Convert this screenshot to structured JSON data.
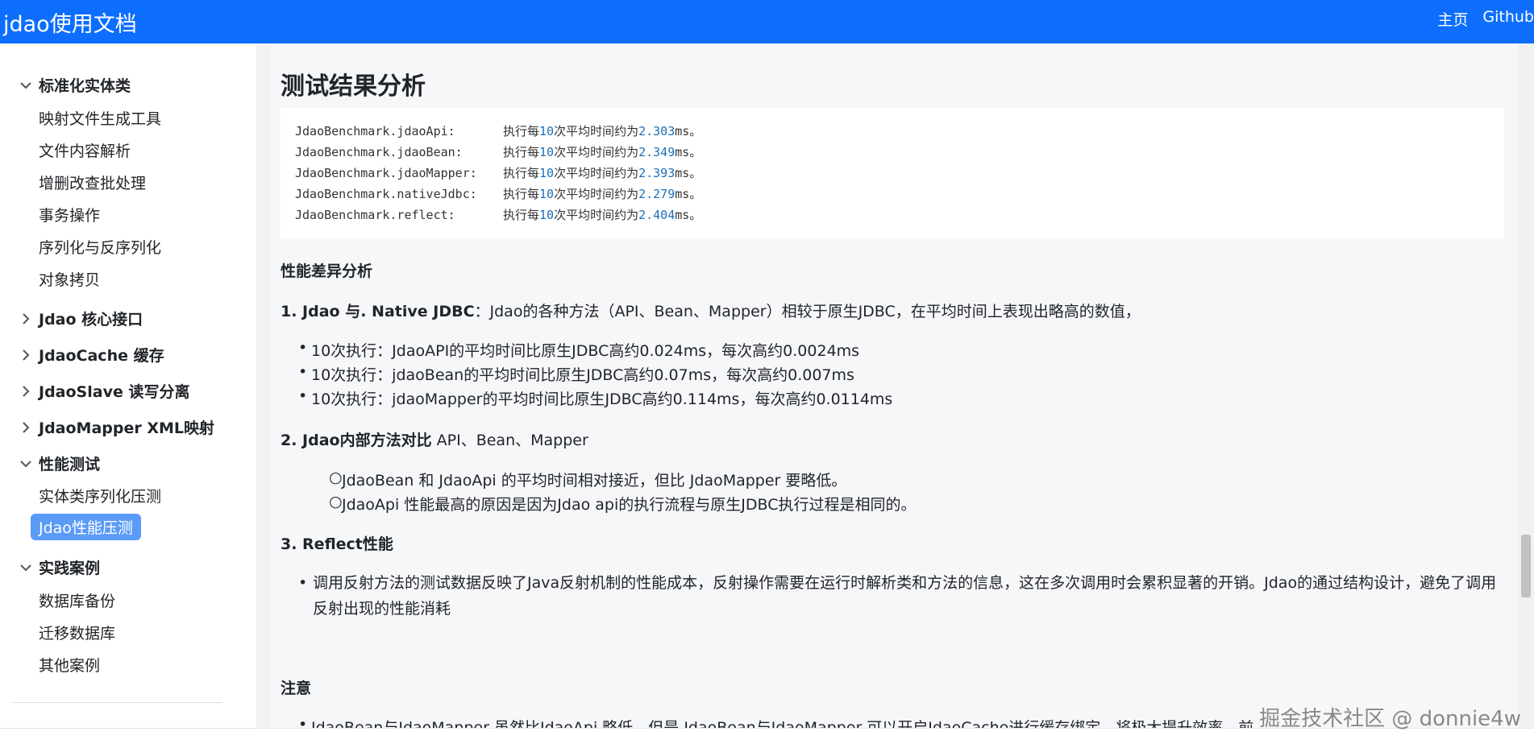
{
  "header": {
    "brand": "jdao使用文档",
    "nav": [
      "主页",
      "Github"
    ]
  },
  "sidebar": {
    "group1": {
      "label": "标准化实体类",
      "items": [
        "映射文件生成工具",
        "文件内容解析",
        "增删改查批处理",
        "事务操作",
        "序列化与反序列化",
        "对象拷贝"
      ]
    },
    "collapsed": [
      "Jdao 核心接口",
      "JdaoCache 缓存",
      "JdaoSlave 读写分离",
      "JdaoMapper XML映射"
    ],
    "group2": {
      "label": "性能测试",
      "items": [
        "实体类序列化压测",
        "Jdao性能压测"
      ]
    },
    "group3": {
      "label": "实践案例",
      "items": [
        "数据库备份",
        "迁移数据库",
        "其他案例"
      ]
    }
  },
  "main": {
    "title": "测试结果分析",
    "code": [
      {
        "method": "JdaoBenchmark.jdaoApi:",
        "a": "执行每",
        "n": "10",
        "b": "次平均时间约为",
        "t": "2.303",
        "c": "ms。"
      },
      {
        "method": "JdaoBenchmark.jdaoBean:",
        "a": "执行每",
        "n": "10",
        "b": "次平均时间约为",
        "t": "2.349",
        "c": "ms。"
      },
      {
        "method": "JdaoBenchmark.jdaoMapper:",
        "a": "执行每",
        "n": "10",
        "b": "次平均时间约为",
        "t": "2.393",
        "c": "ms。"
      },
      {
        "method": "JdaoBenchmark.nativeJdbc:",
        "a": "执行每",
        "n": "10",
        "b": "次平均时间约为",
        "t": "2.279",
        "c": "ms。"
      },
      {
        "method": "JdaoBenchmark.reflect:",
        "a": "执行每",
        "n": "10",
        "b": "次平均时间约为",
        "t": "2.404",
        "c": "ms。"
      }
    ],
    "h_perf": "性能差异分析",
    "p1_bold": "1. Jdao 与. Native JDBC",
    "p1_text": "：Jdao的各种方法（API、Bean、Mapper）相较于原生JDBC，在平均时间上表现出略高的数值，",
    "list1": [
      "10次执行：JdaoAPI的平均时间比原生JDBC高约0.024ms，每次高约0.0024ms",
      "10次执行：jdaoBean的平均时间比原生JDBC高约0.07ms，每次高约0.007ms",
      "10次执行：jdaoMapper的平均时间比原生JDBC高约0.114ms，每次高约0.0114ms"
    ],
    "p2_bold": "2. Jdao内部方法对比",
    "p2_text": " API、Bean、Mapper",
    "list2": [
      "JdaoBean 和 JdaoApi 的平均时间相对接近，但比 JdaoMapper 要略低。",
      "JdaoApi 性能最高的原因是因为Jdao api的执行流程与原生JDBC执行过程是相同的。"
    ],
    "p3_bold": "3. Reflect性能",
    "list3": "调用反射方法的测试数据反映了Java反射机制的性能成本，反射操作需要在运行时解析类和方法的信息，这在多次调用时会累积显著的开销。Jdao的通过结构设计，避免了调用反射出现的性能消耗",
    "h_note": "注意",
    "note_partial": "JdaoBean与JdaoMapper 虽然比JdaoApi 略低，但是 JdaoBean与JdaoMapper 可以开启JdaoCache进行缓存绑定，将极大提升效率，前"
  },
  "watermark": "掘金技术社区 @ donnie4w"
}
